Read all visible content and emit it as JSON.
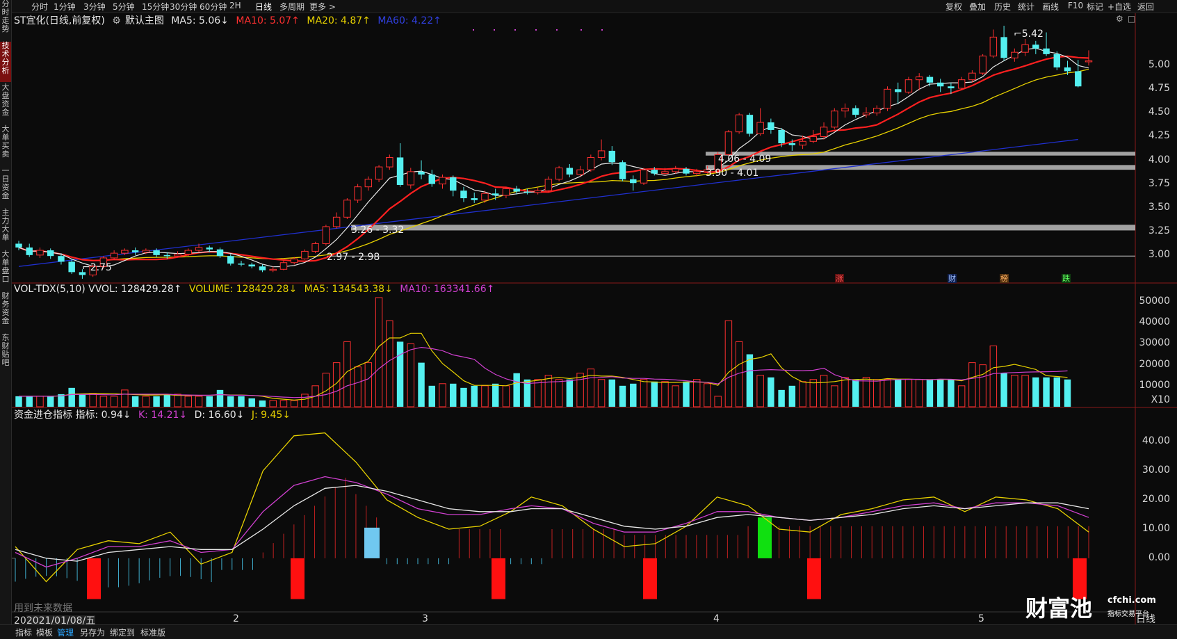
{
  "sidebar": {
    "items": [
      "分时走势",
      "技术分析",
      "大盘资金",
      "大单买卖",
      "一日资金",
      "主力大单",
      "大单盘口",
      "财务资金",
      "东财贴吧"
    ],
    "active_index": 1
  },
  "toolbar": {
    "periods": [
      "分时",
      "1分钟",
      "3分钟",
      "5分钟",
      "15分钟",
      "30分钟",
      "60分钟",
      "2H",
      "日线",
      "多周期",
      "更多 >"
    ],
    "active_period": "日线",
    "right_items": [
      "复权",
      "叠加",
      "历史",
      "统计",
      "画线",
      "F10",
      "标记",
      "+自选",
      "返回"
    ]
  },
  "main_legend": {
    "title": "ST宜化(日线,前复权)",
    "template": "默认主图",
    "ma5": "MA5: 5.06↓",
    "ma10": "MA10: 5.07↑",
    "ma20": "MA20: 4.87↑",
    "ma60": "MA60: 4.22↑"
  },
  "vol_legend": {
    "name": "VOL-TDX(5,10) VVOL: 128429.28↑",
    "volume": "VOLUME: 128429.28↓",
    "ma5": "MA5: 134543.38↓",
    "ma10": "MA10: 163341.66↑"
  },
  "ind_legend": {
    "name": "资金进仓指标 指标: 0.94↓",
    "k": "K: 14.21↓",
    "d": "D: 16.60↓",
    "j": "J: 9.45↓"
  },
  "price_axis": [
    "5.00",
    "4.75",
    "4.50",
    "4.25",
    "4.00",
    "3.75",
    "3.50",
    "3.25",
    "3.00"
  ],
  "volume_axis": [
    "50000",
    "40000",
    "30000",
    "20000",
    "10000",
    "X10"
  ],
  "indicator_axis": [
    "40.00",
    "30.00",
    "20.00",
    "10.00",
    "0.00"
  ],
  "x_axis": {
    "cursor_date": "2021/01/08/五",
    "prefix": "20",
    "months": [
      "2",
      "3",
      "4",
      "5"
    ],
    "period_label": "日线",
    "controls": [
      "+",
      "-"
    ]
  },
  "annotations": {
    "high_label": "5.42",
    "low_label": "2.75",
    "zones": [
      "4.06 - 4.09",
      "3.90 - 4.01",
      "3.26 - 3.32",
      "2.97 - 2.98"
    ],
    "event_marks": [
      "涨",
      "财",
      "榜",
      "跌"
    ],
    "future_data_note": "用到未来数据"
  },
  "watermark": {
    "brand": "财富池",
    "site": "cfchi.com",
    "slogan": "指标交易平台"
  },
  "bottom_tabs": [
    "指标",
    "模板",
    "管理",
    "另存为",
    "绑定到",
    "标准版"
  ],
  "active_bottom_tab": "管理",
  "colors": {
    "up": "#ff3030",
    "down": "#54f0f0",
    "ma5": "#e8e8e8",
    "ma10": "#ff2020",
    "ma20": "#e6d000",
    "ma60": "#2030d0",
    "kline": "#d040d0"
  },
  "chart_data": {
    "type": "candlestick",
    "price_range": [
      2.75,
      5.42
    ],
    "candles": [
      {
        "o": 3.12,
        "c": 3.08,
        "h": 3.15,
        "l": 3.05
      },
      {
        "o": 3.08,
        "c": 3.0,
        "h": 3.12,
        "l": 2.98
      },
      {
        "o": 3.0,
        "c": 3.05,
        "h": 3.08,
        "l": 2.97
      },
      {
        "o": 3.05,
        "c": 2.99,
        "h": 3.07,
        "l": 2.96
      },
      {
        "o": 2.99,
        "c": 2.93,
        "h": 3.02,
        "l": 2.9
      },
      {
        "o": 2.93,
        "c": 2.82,
        "h": 2.96,
        "l": 2.8
      },
      {
        "o": 2.82,
        "c": 2.79,
        "h": 2.85,
        "l": 2.75
      },
      {
        "o": 2.79,
        "c": 2.88,
        "h": 2.9,
        "l": 2.77
      },
      {
        "o": 2.88,
        "c": 2.97,
        "h": 2.99,
        "l": 2.86
      },
      {
        "o": 2.97,
        "c": 3.02,
        "h": 3.05,
        "l": 2.95
      },
      {
        "o": 3.02,
        "c": 3.05,
        "h": 3.07,
        "l": 3.0
      },
      {
        "o": 3.05,
        "c": 3.03,
        "h": 3.08,
        "l": 3.0
      },
      {
        "o": 3.03,
        "c": 3.05,
        "h": 3.07,
        "l": 3.01
      },
      {
        "o": 3.05,
        "c": 3.0,
        "h": 3.07,
        "l": 2.98
      },
      {
        "o": 3.0,
        "c": 2.99,
        "h": 3.03,
        "l": 2.96
      },
      {
        "o": 2.99,
        "c": 3.01,
        "h": 3.04,
        "l": 2.98
      },
      {
        "o": 3.01,
        "c": 3.05,
        "h": 3.07,
        "l": 2.99
      },
      {
        "o": 3.05,
        "c": 3.08,
        "h": 3.12,
        "l": 3.03
      },
      {
        "o": 3.08,
        "c": 3.06,
        "h": 3.1,
        "l": 3.03
      },
      {
        "o": 3.06,
        "c": 2.99,
        "h": 3.08,
        "l": 2.97
      },
      {
        "o": 2.99,
        "c": 2.91,
        "h": 3.01,
        "l": 2.89
      },
      {
        "o": 2.91,
        "c": 2.9,
        "h": 2.94,
        "l": 2.88
      },
      {
        "o": 2.9,
        "c": 2.88,
        "h": 2.92,
        "l": 2.86
      },
      {
        "o": 2.88,
        "c": 2.84,
        "h": 2.9,
        "l": 2.82
      },
      {
        "o": 2.84,
        "c": 2.85,
        "h": 2.88,
        "l": 2.82
      },
      {
        "o": 2.85,
        "c": 2.92,
        "h": 2.94,
        "l": 2.84
      },
      {
        "o": 2.92,
        "c": 2.96,
        "h": 2.98,
        "l": 2.9
      },
      {
        "o": 2.96,
        "c": 3.04,
        "h": 3.06,
        "l": 2.95
      },
      {
        "o": 3.04,
        "c": 3.12,
        "h": 3.14,
        "l": 3.02
      },
      {
        "o": 3.12,
        "c": 3.3,
        "h": 3.32,
        "l": 3.1
      },
      {
        "o": 3.3,
        "c": 3.4,
        "h": 3.45,
        "l": 3.28
      },
      {
        "o": 3.4,
        "c": 3.58,
        "h": 3.6,
        "l": 3.38
      },
      {
        "o": 3.58,
        "c": 3.72,
        "h": 3.75,
        "l": 3.55
      },
      {
        "o": 3.72,
        "c": 3.8,
        "h": 3.83,
        "l": 3.68
      },
      {
        "o": 3.8,
        "c": 3.93,
        "h": 3.95,
        "l": 3.77
      },
      {
        "o": 3.93,
        "c": 4.03,
        "h": 4.06,
        "l": 3.9
      },
      {
        "o": 4.03,
        "c": 3.74,
        "h": 4.18,
        "l": 3.72
      },
      {
        "o": 3.74,
        "c": 3.88,
        "h": 3.92,
        "l": 3.7
      },
      {
        "o": 3.88,
        "c": 3.85,
        "h": 4.0,
        "l": 3.8
      },
      {
        "o": 3.85,
        "c": 3.75,
        "h": 3.9,
        "l": 3.72
      },
      {
        "o": 3.75,
        "c": 3.82,
        "h": 3.85,
        "l": 3.7
      },
      {
        "o": 3.82,
        "c": 3.68,
        "h": 3.84,
        "l": 3.62
      },
      {
        "o": 3.68,
        "c": 3.6,
        "h": 3.72,
        "l": 3.56
      },
      {
        "o": 3.6,
        "c": 3.58,
        "h": 3.66,
        "l": 3.55
      },
      {
        "o": 3.58,
        "c": 3.65,
        "h": 3.68,
        "l": 3.55
      },
      {
        "o": 3.65,
        "c": 3.63,
        "h": 3.7,
        "l": 3.58
      },
      {
        "o": 3.63,
        "c": 3.7,
        "h": 3.72,
        "l": 3.6
      },
      {
        "o": 3.7,
        "c": 3.67,
        "h": 3.73,
        "l": 3.64
      },
      {
        "o": 3.67,
        "c": 3.66,
        "h": 3.7,
        "l": 3.64
      },
      {
        "o": 3.66,
        "c": 3.68,
        "h": 3.71,
        "l": 3.64
      },
      {
        "o": 3.68,
        "c": 3.8,
        "h": 3.83,
        "l": 3.66
      },
      {
        "o": 3.8,
        "c": 3.92,
        "h": 3.94,
        "l": 3.78
      },
      {
        "o": 3.92,
        "c": 3.85,
        "h": 3.96,
        "l": 3.82
      },
      {
        "o": 3.85,
        "c": 3.9,
        "h": 3.94,
        "l": 3.83
      },
      {
        "o": 3.9,
        "c": 4.03,
        "h": 4.06,
        "l": 3.88
      },
      {
        "o": 4.03,
        "c": 4.1,
        "h": 4.22,
        "l": 4.0
      },
      {
        "o": 4.1,
        "c": 3.98,
        "h": 4.15,
        "l": 3.95
      },
      {
        "o": 3.98,
        "c": 3.8,
        "h": 4.0,
        "l": 3.78
      },
      {
        "o": 3.8,
        "c": 3.76,
        "h": 3.84,
        "l": 3.68
      },
      {
        "o": 3.76,
        "c": 3.9,
        "h": 3.92,
        "l": 3.74
      },
      {
        "o": 3.9,
        "c": 3.86,
        "h": 3.93,
        "l": 3.84
      },
      {
        "o": 3.86,
        "c": 3.88,
        "h": 3.92,
        "l": 3.84
      },
      {
        "o": 3.88,
        "c": 3.91,
        "h": 3.94,
        "l": 3.86
      },
      {
        "o": 3.91,
        "c": 3.86,
        "h": 3.93,
        "l": 3.84
      },
      {
        "o": 3.86,
        "c": 3.88,
        "h": 3.91,
        "l": 3.83
      },
      {
        "o": 3.88,
        "c": 3.9,
        "h": 3.94,
        "l": 3.86
      },
      {
        "o": 3.9,
        "c": 4.06,
        "h": 4.09,
        "l": 3.89
      },
      {
        "o": 4.06,
        "c": 4.3,
        "h": 4.32,
        "l": 4.05
      },
      {
        "o": 4.3,
        "c": 4.48,
        "h": 4.5,
        "l": 4.28
      },
      {
        "o": 4.48,
        "c": 4.28,
        "h": 4.5,
        "l": 4.25
      },
      {
        "o": 4.28,
        "c": 4.4,
        "h": 4.55,
        "l": 4.26
      },
      {
        "o": 4.4,
        "c": 4.32,
        "h": 4.44,
        "l": 4.28
      },
      {
        "o": 4.32,
        "c": 4.18,
        "h": 4.34,
        "l": 4.14
      },
      {
        "o": 4.18,
        "c": 4.16,
        "h": 4.22,
        "l": 4.1
      },
      {
        "o": 4.16,
        "c": 4.2,
        "h": 4.26,
        "l": 4.12
      },
      {
        "o": 4.2,
        "c": 4.25,
        "h": 4.32,
        "l": 4.18
      },
      {
        "o": 4.25,
        "c": 4.35,
        "h": 4.4,
        "l": 4.22
      },
      {
        "o": 4.35,
        "c": 4.52,
        "h": 4.55,
        "l": 4.33
      },
      {
        "o": 4.52,
        "c": 4.55,
        "h": 4.6,
        "l": 4.45
      },
      {
        "o": 4.55,
        "c": 4.48,
        "h": 4.58,
        "l": 4.45
      },
      {
        "o": 4.48,
        "c": 4.5,
        "h": 4.56,
        "l": 4.45
      },
      {
        "o": 4.5,
        "c": 4.55,
        "h": 4.58,
        "l": 4.47
      },
      {
        "o": 4.55,
        "c": 4.75,
        "h": 4.78,
        "l": 4.52
      },
      {
        "o": 4.75,
        "c": 4.72,
        "h": 4.82,
        "l": 4.6
      },
      {
        "o": 4.72,
        "c": 4.85,
        "h": 4.88,
        "l": 4.7
      },
      {
        "o": 4.85,
        "c": 4.88,
        "h": 4.92,
        "l": 4.74
      },
      {
        "o": 4.88,
        "c": 4.82,
        "h": 4.9,
        "l": 4.78
      },
      {
        "o": 4.82,
        "c": 4.78,
        "h": 4.86,
        "l": 4.72
      },
      {
        "o": 4.78,
        "c": 4.76,
        "h": 4.82,
        "l": 4.7
      },
      {
        "o": 4.76,
        "c": 4.85,
        "h": 4.88,
        "l": 4.74
      },
      {
        "o": 4.85,
        "c": 4.92,
        "h": 4.95,
        "l": 4.82
      },
      {
        "o": 4.92,
        "c": 5.1,
        "h": 5.12,
        "l": 4.9
      },
      {
        "o": 5.1,
        "c": 5.3,
        "h": 5.38,
        "l": 5.08
      },
      {
        "o": 5.3,
        "c": 5.08,
        "h": 5.42,
        "l": 5.05
      },
      {
        "o": 5.08,
        "c": 5.14,
        "h": 5.18,
        "l": 5.04
      },
      {
        "o": 5.14,
        "c": 5.22,
        "h": 5.28,
        "l": 5.1
      },
      {
        "o": 5.22,
        "c": 5.18,
        "h": 5.26,
        "l": 5.12
      },
      {
        "o": 5.18,
        "c": 5.12,
        "h": 5.35,
        "l": 5.1
      },
      {
        "o": 5.12,
        "c": 4.98,
        "h": 5.15,
        "l": 4.95
      },
      {
        "o": 4.98,
        "c": 4.94,
        "h": 5.05,
        "l": 4.9
      },
      {
        "o": 4.94,
        "c": 4.78,
        "h": 5.06,
        "l": 4.77
      },
      {
        "o": 5.04,
        "c": 5.05,
        "h": 5.16,
        "l": 5.0
      }
    ],
    "ma60": [
      [
        0,
        2.88
      ],
      [
        100,
        4.22
      ]
    ],
    "volume_ma_legend": [
      "MA5",
      "MA10"
    ],
    "volume_values": [
      5,
      5,
      5,
      5,
      6,
      9,
      6,
      6,
      5,
      5,
      8,
      5,
      5,
      5,
      6,
      6,
      5,
      5,
      5,
      8,
      5,
      5,
      4,
      3,
      3,
      3,
      3,
      6,
      10,
      16,
      21,
      31,
      19,
      21,
      52,
      41,
      31,
      30,
      21,
      10,
      11,
      11,
      9,
      10,
      10,
      11,
      10,
      16,
      13,
      13,
      15,
      13,
      13,
      16,
      18,
      13,
      13,
      10,
      11,
      13,
      12,
      12,
      10,
      12,
      13,
      11,
      5,
      41,
      31,
      25,
      15,
      14,
      8,
      10,
      12,
      13,
      15,
      10,
      14,
      13,
      14,
      13,
      13,
      13,
      13,
      13,
      13,
      13,
      13,
      10,
      21,
      20,
      29,
      16,
      15,
      15,
      14,
      14,
      14,
      13
    ]
  }
}
